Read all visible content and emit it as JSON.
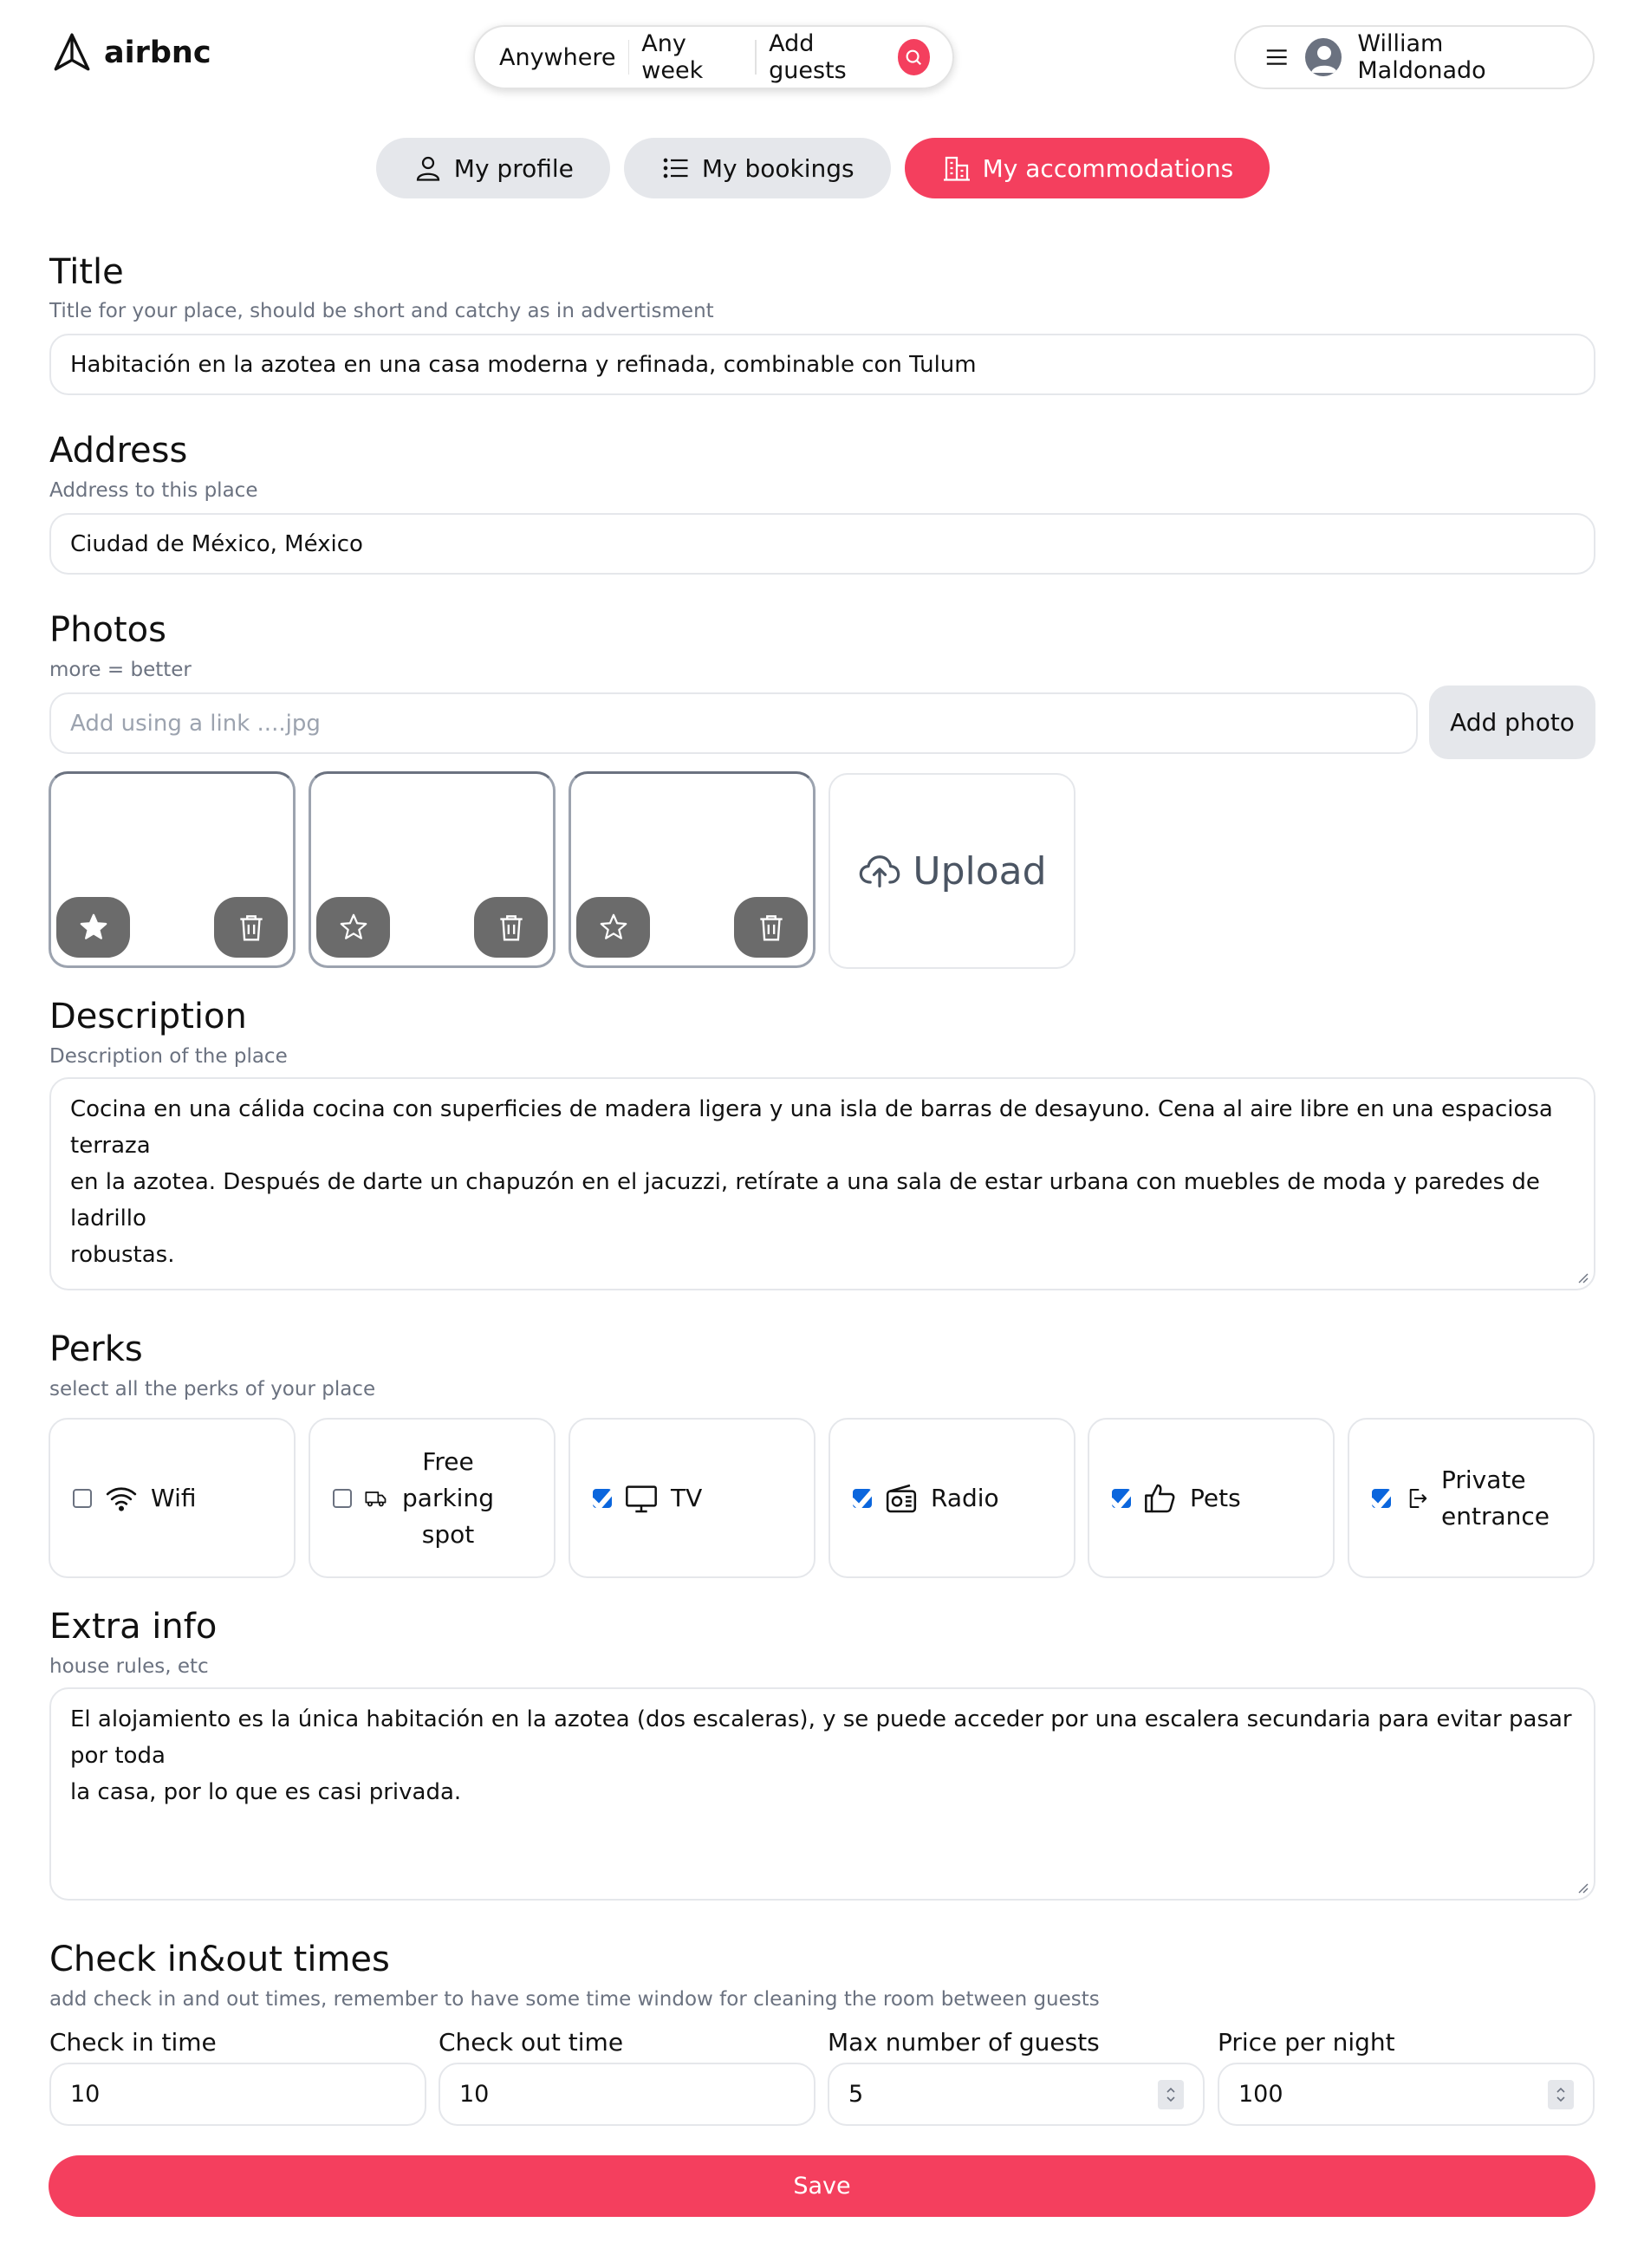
{
  "app": {
    "brand": "airbnc"
  },
  "search": {
    "anywhere": "Anywhere",
    "any_week": "Any week",
    "add_guests": "Add guests"
  },
  "user": {
    "name": "William Maldonado"
  },
  "tabs": [
    {
      "label": "My profile"
    },
    {
      "label": "My bookings"
    },
    {
      "label": "My accommodations",
      "active": true
    }
  ],
  "title_section": {
    "heading": "Title",
    "hint": "Title for your place, should be short and catchy as in advertisment",
    "value": "Habitación en la azotea en una casa moderna y refinada, combinable con Tulum"
  },
  "address_section": {
    "heading": "Address",
    "hint": "Address to this place",
    "value": "Ciudad de México, México"
  },
  "photos_section": {
    "heading": "Photos",
    "hint": "more = better",
    "link_placeholder": "Add using a link ....jpg",
    "add_button": "Add photo",
    "upload_label": "Upload",
    "photos": [
      {
        "main": true
      },
      {
        "main": false
      },
      {
        "main": false
      }
    ]
  },
  "description_section": {
    "heading": "Description",
    "hint": "Description of the place",
    "line1": "Cocina en una cálida cocina con superficies de madera ligera y una isla de barras de desayuno. Cena al aire libre en una espaciosa terraza",
    "line2": "en la azotea. Después de darte un chapuzón en el jacuzzi, retírate a una sala de estar urbana con muebles de moda y paredes de ladrillo",
    "line3": "robustas."
  },
  "perks_section": {
    "heading": "Perks",
    "hint": "select all the perks of your place",
    "perks": [
      {
        "label": "Wifi",
        "checked": false,
        "icon": "wifi-icon"
      },
      {
        "label": "Free parking spot",
        "checked": false,
        "icon": "truck-icon"
      },
      {
        "label": "TV",
        "checked": true,
        "icon": "tv-icon"
      },
      {
        "label": "Radio",
        "checked": true,
        "icon": "radio-icon"
      },
      {
        "label": "Pets",
        "checked": true,
        "icon": "thumb-up-icon"
      },
      {
        "label": "Private entrance",
        "checked": true,
        "icon": "entrance-icon"
      }
    ]
  },
  "extra_section": {
    "heading": "Extra info",
    "hint": "house rules, etc",
    "line1": "El alojamiento es la única habitación en la azotea (dos escaleras), y se puede acceder por una escalera secundaria para evitar pasar por toda",
    "line2": "la casa, por lo que es casi privada."
  },
  "checkin_section": {
    "heading": "Check in&out times",
    "hint": "add check in and out times, remember to have some time window for cleaning the room between guests",
    "check_in_label": "Check in time",
    "check_in_value": "10",
    "check_out_label": "Check out time",
    "check_out_value": "10",
    "max_guests_label": "Max number of guests",
    "max_guests_value": "5",
    "price_label": "Price per night",
    "price_value": "100"
  },
  "save_button": "Save",
  "colors": {
    "accent": "#f43f5e",
    "checkbox": "#0b66dd",
    "muted": "#6b7280",
    "border": "#e5e7eb"
  }
}
